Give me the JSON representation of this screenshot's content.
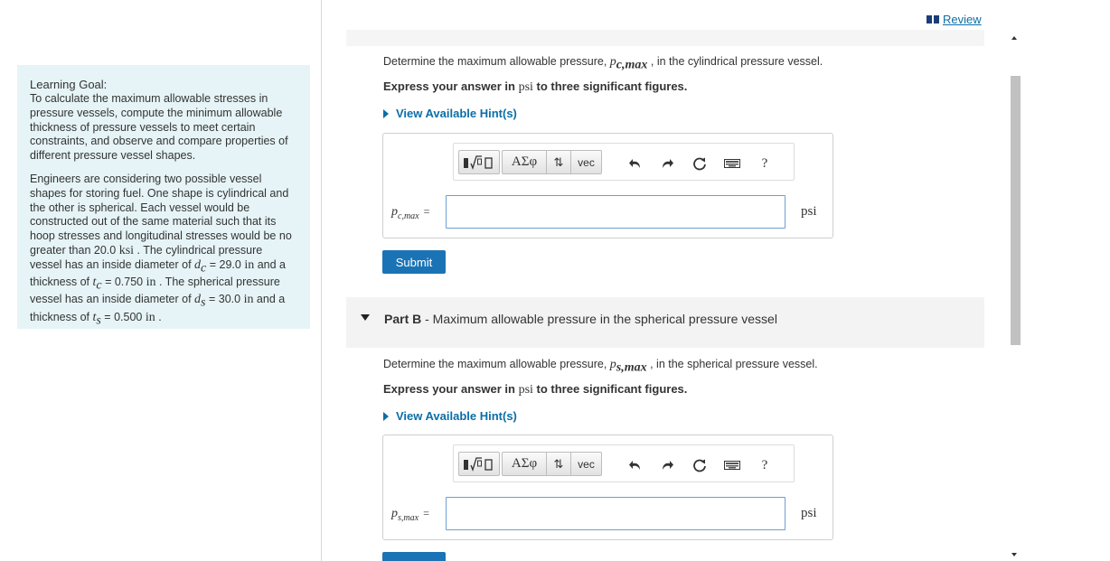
{
  "review": {
    "label": "Review"
  },
  "learning_goal": {
    "title": "Learning Goal:",
    "text": "To calculate the maximum allowable stresses in pressure vessels, compute the minimum allowable thickness of pressure vessels to meet certain constraints, and observe and compare properties of different pressure vessel shapes.",
    "p2_a": "Engineers are considering two possible vessel shapes for storing fuel. One shape is cylindrical and the other is spherical. Each vessel would be constructed out of the same material such that its hoop stresses and longitudinal stresses would be no greater than 20.0 ",
    "ksi": "ksi",
    "p2_b": " . The cylindrical pressure vessel has an inside diameter of ",
    "dc_var": "d",
    "dc_sub": "c",
    "dc_val": " = 29.0 ",
    "in1": "in",
    "p2_c": " and a thickness of ",
    "tc_var": "t",
    "tc_sub": "c",
    "tc_val": " = 0.750 ",
    "in2": "in",
    "p2_d": " . The spherical pressure vessel has an inside diameter of ",
    "ds_var": "d",
    "ds_sub": "s",
    "ds_val": " = 30.0 ",
    "in3": "in",
    "p2_e": " and a thickness of ",
    "ts_var": "t",
    "ts_sub": "s",
    "ts_val": " = 0.500 ",
    "in4": "in",
    "p2_f": " ."
  },
  "partA": {
    "question_a": "Determine the maximum allowable pressure, ",
    "var": "p",
    "var_sub": "c,max",
    "question_b": " , in the cylindrical pressure vessel.",
    "instr_a": "Express your answer in ",
    "instr_unit": "psi",
    "instr_b": " to three significant figures.",
    "hint": "View Available Hint(s)",
    "label_var": "p",
    "label_sub": "c,max",
    "eq": "=",
    "input_value": "",
    "unit": "psi",
    "submit": "Submit"
  },
  "partB": {
    "part_label": "Part B",
    "part_title": " - Maximum allowable pressure in the spherical pressure vessel",
    "question_a": "Determine the maximum allowable pressure, ",
    "var": "p",
    "var_sub": "s,max",
    "question_b": " , in the spherical pressure vessel.",
    "instr_a": "Express your answer in ",
    "instr_unit": "psi",
    "instr_b": " to three significant figures.",
    "hint": "View Available Hint(s)",
    "label_var": "p",
    "label_sub": "s,max",
    "eq": "=",
    "input_value": "",
    "unit": "psi"
  },
  "toolbar": {
    "greek": "ΑΣφ",
    "arrows": "⇅",
    "vec": "vec",
    "help": "?"
  },
  "icons": [
    "templates-icon",
    "greek-icon",
    "arrows-icon",
    "vec-icon",
    "undo-icon",
    "redo-icon",
    "reset-icon",
    "keyboard-icon",
    "help-icon"
  ]
}
